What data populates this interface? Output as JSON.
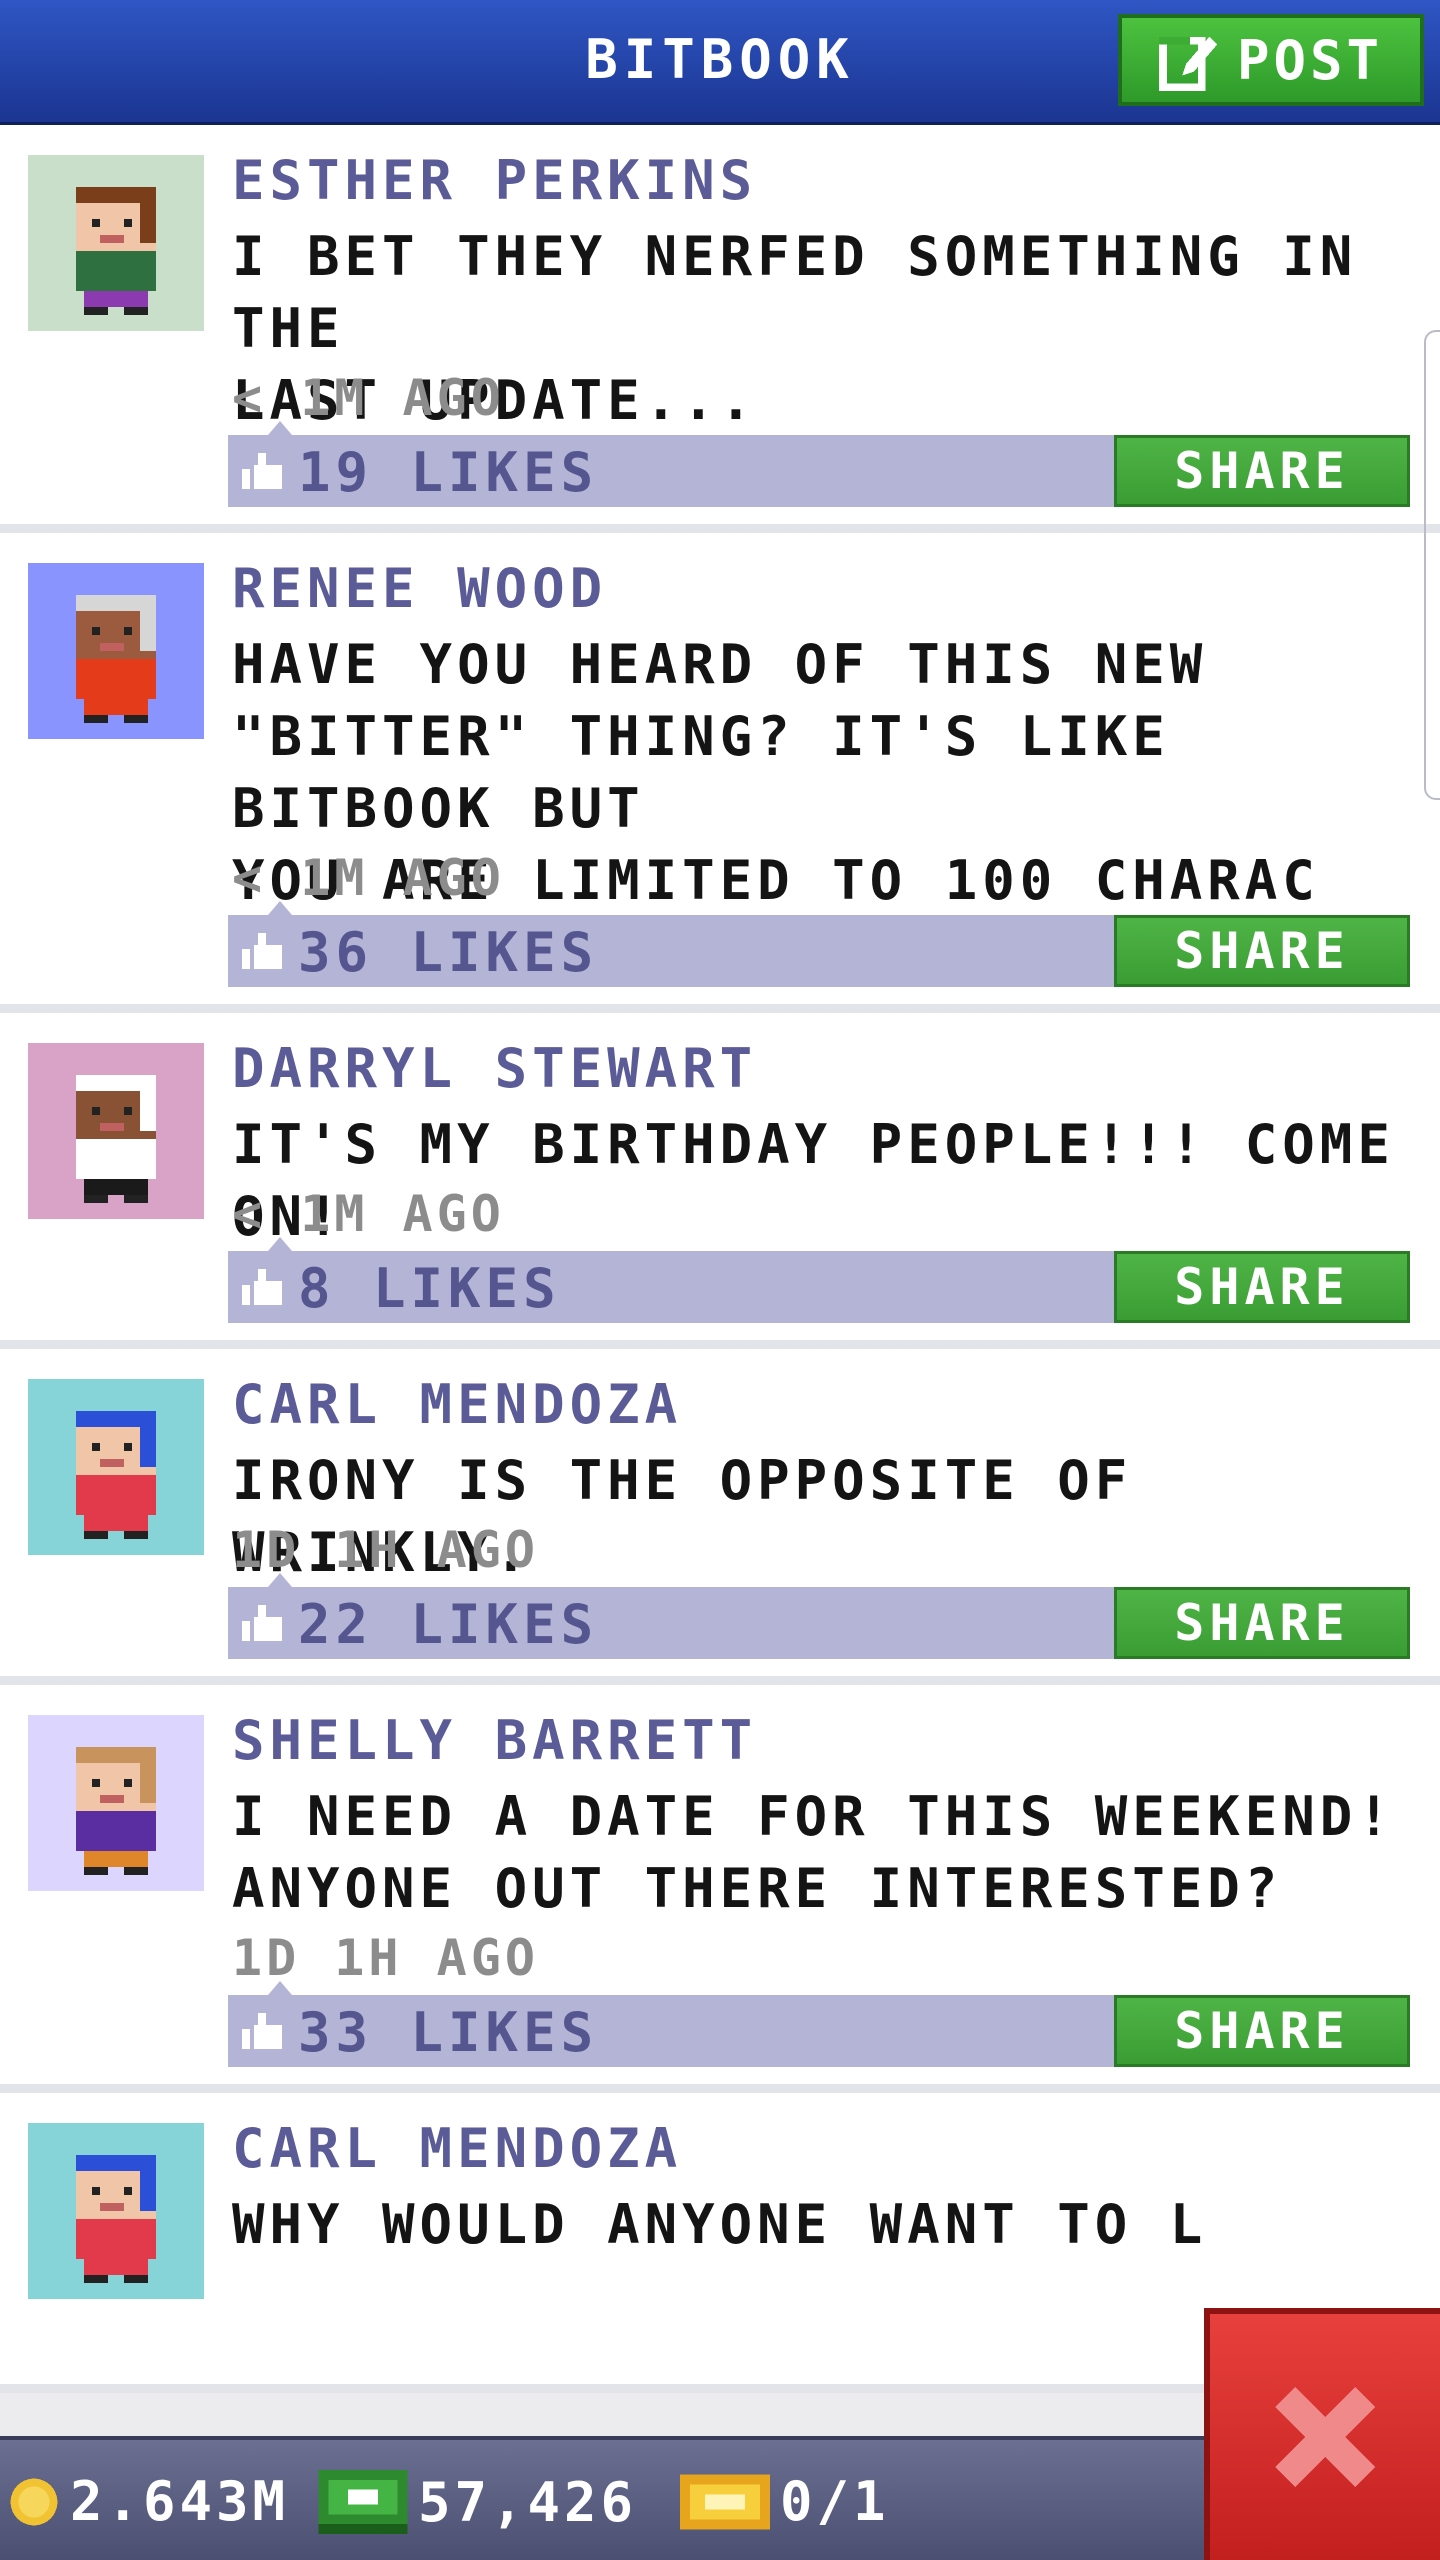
{
  "header": {
    "title": "BITBOOK",
    "post_label": "POST"
  },
  "colors": {
    "header_blue": "#2344a8",
    "post_green": "#3cac35",
    "author_purple": "#5b5b97",
    "likebar_lavender": "#b4b4d6",
    "close_red": "#d62b2b"
  },
  "posts": [
    {
      "author": "ESTHER PERKINS",
      "lines": [
        "I BET THEY NERFED SOMETHING IN THE",
        "LAST UPDATE..."
      ],
      "time": "< 1M AGO",
      "likes": "19 LIKES",
      "share_label": "SHARE",
      "avatar_bg": "#c9dfc9",
      "avatar_hair": "#7a3f1a",
      "avatar_skin": "#f1c6a8",
      "avatar_shirt": "#2e7040",
      "avatar_pants": "#8b3ab0"
    },
    {
      "author": "RENEE WOOD",
      "lines": [
        "HAVE YOU HEARD OF THIS NEW",
        "\"BITTER\" THING? IT'S LIKE BITBOOK BUT",
        "YOU ARE LIMITED TO 100 CHARAC"
      ],
      "time": "< 1M AGO",
      "likes": "36 LIKES",
      "share_label": "SHARE",
      "avatar_bg": "#8a94ff",
      "avatar_hair": "#d6d6d6",
      "avatar_skin": "#9c5b3f",
      "avatar_shirt": "#e43b1a",
      "avatar_pants": "#e43b1a"
    },
    {
      "author": "DARRYL STEWART",
      "lines": [
        "IT'S MY BIRTHDAY PEOPLE!!! COME ON!"
      ],
      "time": "< 1M AGO",
      "likes": "8 LIKES",
      "share_label": "SHARE",
      "avatar_bg": "#d9a3c8",
      "avatar_hair": "#ffffff",
      "avatar_skin": "#8a5235",
      "avatar_shirt": "#ffffff",
      "avatar_pants": "#1a1a1a"
    },
    {
      "author": "CARL MENDOZA",
      "lines": [
        "IRONY IS THE OPPOSITE OF WRINKLY."
      ],
      "time": "1D 1H AGO",
      "likes": "22 LIKES",
      "share_label": "SHARE",
      "avatar_bg": "#86d4d8",
      "avatar_hair": "#2b4fd6",
      "avatar_skin": "#f1c6a8",
      "avatar_shirt": "#e23a4a",
      "avatar_pants": "#e23a4a"
    },
    {
      "author": "SHELLY BARRETT",
      "lines": [
        "I NEED A DATE FOR THIS WEEKEND!",
        "ANYONE OUT THERE INTERESTED?"
      ],
      "time": "1D 1H AGO",
      "likes": "33 LIKES",
      "share_label": "SHARE",
      "avatar_bg": "#dcd6ff",
      "avatar_hair": "#c8935c",
      "avatar_skin": "#f1c6a8",
      "avatar_shirt": "#5a2ea0",
      "avatar_pants": "#e0862a"
    },
    {
      "author": "CARL MENDOZA",
      "lines": [
        "WHY WOULD ANYONE WANT TO L"
      ],
      "time": "",
      "likes": "",
      "share_label": "",
      "avatar_bg": "#86d4d8",
      "avatar_hair": "#2b4fd6",
      "avatar_skin": "#f1c6a8",
      "avatar_shirt": "#e23a4a",
      "avatar_pants": "#e23a4a"
    }
  ],
  "status_bar": {
    "coins": "2.643M",
    "bux": "57,426",
    "tickets": "0/1"
  }
}
